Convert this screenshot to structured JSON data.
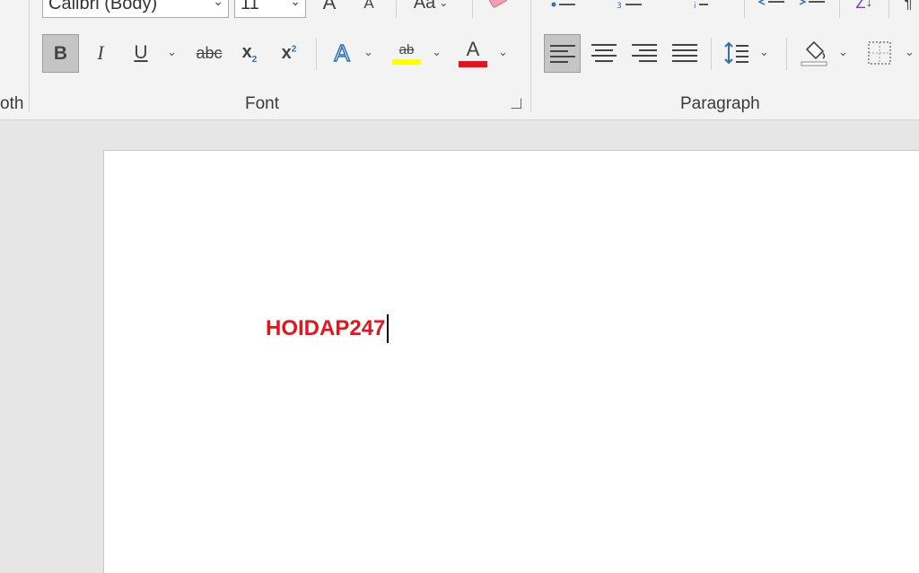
{
  "ribbon": {
    "partial_left_group_label": "oth",
    "font_group": {
      "label": "Font",
      "font_name": "Calibri (Body)",
      "font_size": "11",
      "grow_font_glyph": "A",
      "shrink_font_glyph": "A",
      "change_case_glyph": "Aa",
      "bold_glyph": "B",
      "italic_glyph": "I",
      "underline_glyph": "U",
      "strikethrough_glyph": "abc",
      "subscript_base": "x",
      "subscript_mark": "2",
      "superscript_base": "x",
      "superscript_mark": "2",
      "text_effects_glyph": "A",
      "highlight_glyph": "ab",
      "highlight_color": "#ffff00",
      "font_color_glyph": "A",
      "font_color": "#e8141c"
    },
    "paragraph_group": {
      "label": "Paragraph",
      "sort_glyph": "Z"
    }
  },
  "document": {
    "text": "HOIDAP247",
    "text_color": "#e8141c"
  }
}
